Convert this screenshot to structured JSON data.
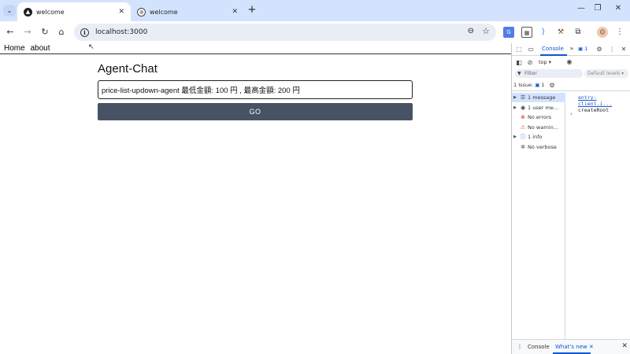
{
  "browser": {
    "tabs": [
      {
        "title": "welcome",
        "active": true
      },
      {
        "title": "welcome",
        "active": false
      }
    ],
    "new_tab_icon": "+",
    "url": "localhost:3000"
  },
  "page": {
    "nav_links": [
      "Home",
      "about"
    ],
    "heading": "Agent-Chat",
    "input_value": "price-list-updown-agent 最低金額: 100 円 , 最高金額: 200 円",
    "button_label": "GO"
  },
  "devtools": {
    "console_tab": "Console",
    "issue_badge": "1",
    "context": "top ▾",
    "filter_placeholder": "Filter",
    "levels": "Default levels ▾",
    "issues_label": "1 Issue:",
    "issues_count": "1",
    "sidebar_items": [
      {
        "label": "1 message",
        "icon": "list-icon",
        "glyph": "☰",
        "color": "#444",
        "expandable": true,
        "selected": true
      },
      {
        "label": "1 user me...",
        "icon": "user-icon",
        "glyph": "◉",
        "color": "#444",
        "expandable": true,
        "selected": false
      },
      {
        "label": "No errors",
        "icon": "error-icon",
        "glyph": "⊗",
        "color": "#d93025",
        "expandable": false,
        "selected": false
      },
      {
        "label": "No warnin...",
        "icon": "warning-icon",
        "glyph": "⚠",
        "color": "#b06000",
        "expandable": false,
        "selected": false
      },
      {
        "label": "1 info",
        "icon": "info-icon",
        "glyph": "ⓘ",
        "color": "#1a56c9",
        "expandable": true,
        "selected": false
      },
      {
        "label": "No verbose",
        "icon": "bug-icon",
        "glyph": "✲",
        "color": "#444",
        "expandable": false,
        "selected": false
      }
    ],
    "console_source": "entry-client.i...",
    "console_message": "createRoot",
    "drawer_console": "Console",
    "drawer_whats_new": "What's new ✕"
  }
}
